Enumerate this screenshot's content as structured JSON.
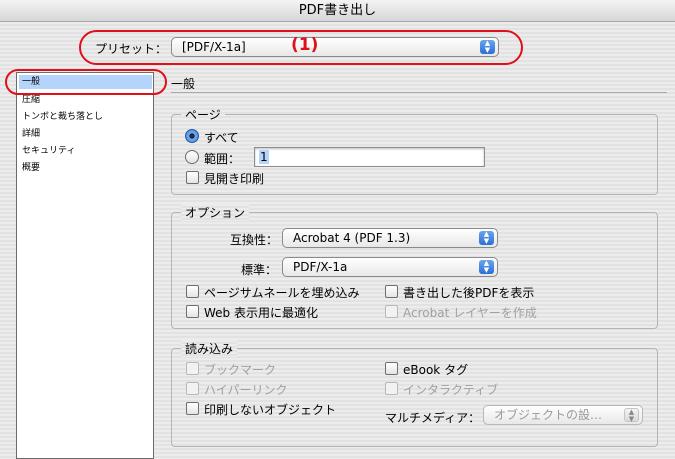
{
  "window": {
    "title": "PDF書き出し"
  },
  "preset": {
    "label": "プリセット：",
    "value": "[PDF/X-1a]"
  },
  "annotation": {
    "number": "(1)",
    "color": "#e0101a"
  },
  "sidebar": {
    "items": [
      {
        "label": "一般",
        "selected": true
      },
      {
        "label": "圧縮"
      },
      {
        "label": "トンボと裁ち落とし"
      },
      {
        "label": "詳細"
      },
      {
        "label": "セキュリティ"
      },
      {
        "label": "概要"
      }
    ]
  },
  "main": {
    "title": "一般",
    "pages": {
      "title": "ページ",
      "all_label": "すべて",
      "range_label": "範囲：",
      "range_value": "1",
      "spreads_label": "見開き印刷"
    },
    "options": {
      "title": "オプション",
      "compat_label": "互換性：",
      "compat_value": "Acrobat 4 (PDF 1.3)",
      "standard_label": "標準：",
      "standard_value": "PDF/X-1a",
      "thumbnails_label": "ページサムネールを埋め込み",
      "view_after_label": "書き出した後PDFを表示",
      "optimize_web_label": "Web 表示用に最適化",
      "acrobat_layers_label": "Acrobat レイヤーを作成"
    },
    "include": {
      "title": "読み込み",
      "bookmarks_label": "ブックマーク",
      "ebook_tags_label": "eBook タグ",
      "hyperlinks_label": "ハイパーリンク",
      "interactive_label": "インタラクティブ",
      "nonprint_label": "印刷しないオブジェクト",
      "multimedia_label": "マルチメディア：",
      "multimedia_value": "オブジェクトの設…"
    }
  }
}
